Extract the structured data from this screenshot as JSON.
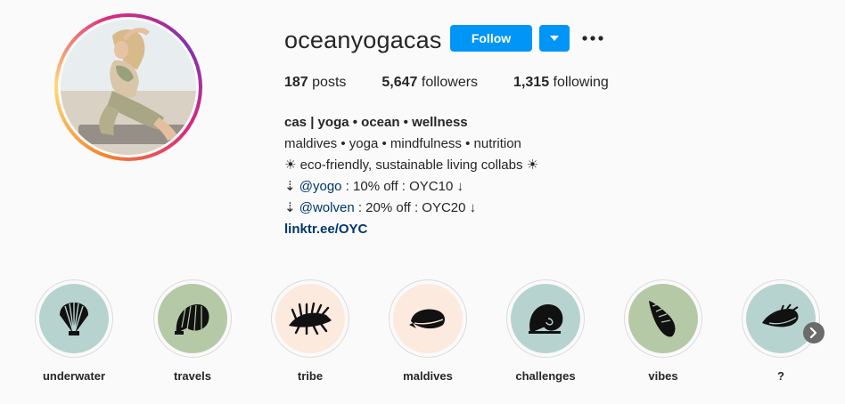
{
  "profile": {
    "username": "oceanyogacas",
    "follow_label": "Follow",
    "dropdown_icon": "caret-down-icon",
    "more_icon": "ellipsis-icon"
  },
  "stats": [
    {
      "count": "187",
      "label": "posts"
    },
    {
      "count": "5,647",
      "label": "followers"
    },
    {
      "count": "1,315",
      "label": "following"
    }
  ],
  "bio": {
    "name": "cas | yoga • ocean • wellness",
    "line1": "maldives • yoga • mindfulness • nutrition",
    "line2": "☀ eco-friendly, sustainable living collabs ☀",
    "line3_prefix": "⇣ ",
    "line3_mention": "@yogo",
    "line3_suffix": " : 10% off : OYC10 ↓",
    "line4_prefix": "⇣ ",
    "line4_mention": "@wolven",
    "line4_suffix": " : 20% off : OYC20 ↓",
    "link": "linktr.ee/OYC"
  },
  "highlights": [
    {
      "label": "underwater",
      "bg": "#b7d3cf",
      "icon": "scallop-shell-icon"
    },
    {
      "label": "travels",
      "bg": "#b5c9a6",
      "icon": "nautilus-shell-icon"
    },
    {
      "label": "tribe",
      "bg": "#fbeadd",
      "icon": "spiky-shell-icon"
    },
    {
      "label": "maldives",
      "bg": "#fbeadd",
      "icon": "cowrie-shell-icon"
    },
    {
      "label": "challenges",
      "bg": "#b7d3cf",
      "icon": "snail-shell-icon"
    },
    {
      "label": "vibes",
      "bg": "#b5c9a6",
      "icon": "conch-shell-icon"
    },
    {
      "label": "?",
      "bg": "#b7d3cf",
      "icon": "whelk-shell-icon"
    }
  ],
  "colors": {
    "accent": "#0095f6",
    "link": "#00376b"
  }
}
